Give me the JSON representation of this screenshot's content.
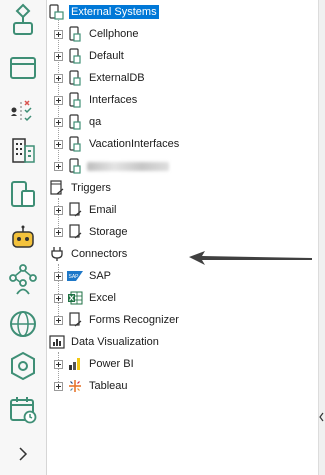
{
  "tree": {
    "sections": [
      {
        "label": "External Systems",
        "selected": true,
        "icon": "external-system-icon",
        "items": [
          {
            "label": "Cellphone",
            "icon": "device-icon"
          },
          {
            "label": "Default",
            "icon": "device-icon"
          },
          {
            "label": "ExternalDB",
            "icon": "device-icon"
          },
          {
            "label": "Interfaces",
            "icon": "device-icon"
          },
          {
            "label": "qa",
            "icon": "device-icon"
          },
          {
            "label": "VacationInterfaces",
            "icon": "device-icon"
          },
          {
            "label": "",
            "icon": "device-icon",
            "redacted": true
          }
        ]
      },
      {
        "label": "Triggers",
        "icon": "trigger-icon",
        "items": [
          {
            "label": "Email",
            "icon": "trigger-icon"
          },
          {
            "label": "Storage",
            "icon": "trigger-icon"
          }
        ]
      },
      {
        "label": "Connectors",
        "icon": "plug-icon",
        "items": [
          {
            "label": "SAP",
            "icon": "sap-icon"
          },
          {
            "label": "Excel",
            "icon": "excel-icon"
          },
          {
            "label": "Forms Recognizer",
            "icon": "forms-recognizer-icon"
          }
        ]
      },
      {
        "label": "Data Visualization",
        "icon": "chart-icon",
        "items": [
          {
            "label": "Power BI",
            "icon": "power-bi-icon"
          },
          {
            "label": "Tableau",
            "icon": "tableau-icon"
          }
        ]
      }
    ]
  },
  "rail": {
    "items": [
      {
        "name": "process-modeler-icon"
      },
      {
        "name": "forms-icon"
      },
      {
        "name": "rules-icon"
      },
      {
        "name": "organization-icon"
      },
      {
        "name": "devices-icon"
      },
      {
        "name": "bot-icon"
      },
      {
        "name": "people-network-icon"
      },
      {
        "name": "globe-icon"
      },
      {
        "name": "settings-icon"
      },
      {
        "name": "calendar-icon"
      },
      {
        "name": "expand-chevron-icon"
      }
    ]
  },
  "colors": {
    "accent": "#0078d7",
    "rail_icon": "#3f8f76"
  }
}
